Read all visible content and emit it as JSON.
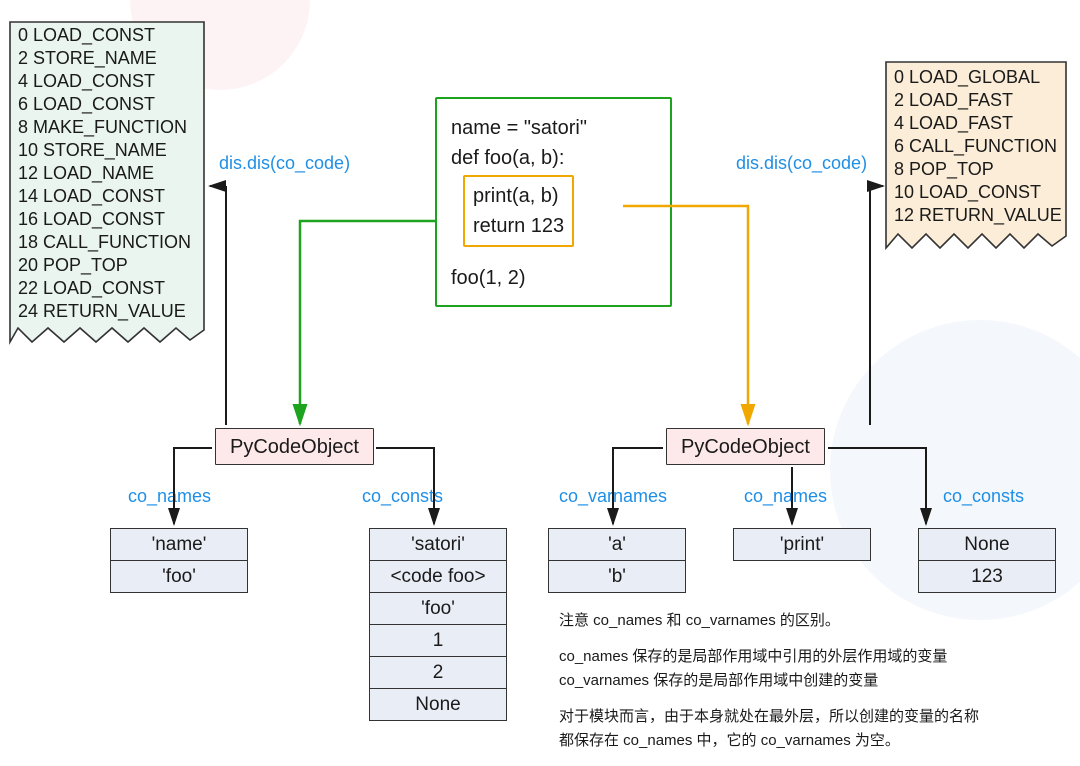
{
  "left_dis": {
    "label": "dis.dis(co_code)",
    "items": [
      "0 LOAD_CONST",
      "2 STORE_NAME",
      "4 LOAD_CONST",
      "6 LOAD_CONST",
      "8 MAKE_FUNCTION",
      "10 STORE_NAME",
      "12 LOAD_NAME",
      "14 LOAD_CONST",
      "16 LOAD_CONST",
      "18 CALL_FUNCTION",
      "20 POP_TOP",
      "22 LOAD_CONST",
      "24 RETURN_VALUE"
    ]
  },
  "right_dis": {
    "label": "dis.dis(co_code)",
    "items": [
      "0 LOAD_GLOBAL",
      "2 LOAD_FAST",
      "4 LOAD_FAST",
      "6 CALL_FUNCTION",
      "8 POP_TOP",
      "10 LOAD_CONST",
      "12 RETURN_VALUE"
    ]
  },
  "code": {
    "line1": "name = \"satori\"",
    "line2": "def foo(a, b):",
    "inner1": "print(a, b)",
    "inner2": "return 123",
    "line3": "foo(1, 2)"
  },
  "pycode_label": "PyCodeObject",
  "arrow_labels": {
    "co_names": "co_names",
    "co_consts": "co_consts",
    "co_varnames": "co_varnames"
  },
  "left_co_names": [
    "'name'",
    "'foo'"
  ],
  "left_co_consts": [
    "'satori'",
    "<code foo>",
    "'foo'",
    "1",
    "2",
    "None"
  ],
  "right_co_varnames": [
    "'a'",
    "'b'"
  ],
  "right_co_names": [
    "'print'"
  ],
  "right_co_consts": [
    "None",
    "123"
  ],
  "notes": {
    "p1": "注意 co_names 和 co_varnames 的区别。",
    "p2a": "co_names 保存的是局部作用域中引用的外层作用域的变量",
    "p2b": "co_varnames 保存的是局部作用域中创建的变量",
    "p3a": "对于模块而言，由于本身就处在最外层，所以创建的变量的名称",
    "p3b": "都保存在 co_names 中，它的 co_varnames 为空。"
  },
  "colors": {
    "green": "#1da31d",
    "orange": "#f0a800",
    "blue_label": "#1f8fe6",
    "left_fill": "#e9f5ee",
    "right_fill": "#fbedd7",
    "pink": "#fde8ea",
    "cell": "#e9edf6"
  }
}
